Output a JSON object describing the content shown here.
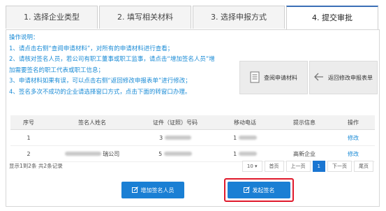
{
  "tabs": [
    {
      "label": "1. 选择企业类型",
      "active": false
    },
    {
      "label": "2. 填写相关材料",
      "active": false
    },
    {
      "label": "3. 选择申报方式",
      "active": false
    },
    {
      "label": "4. 提交审批",
      "active": true
    }
  ],
  "instructions": {
    "title": "操作说明：",
    "lines": [
      "1、请点击右侧“查阅申请材料”，对所有的申请材料进行查看；",
      "2、请核对签名人员，若公司有职工董事或职工监事，请点击“增加签名人员”增",
      "加需要签名的职工代表或职工信息；",
      "3、申请材料如果有误，可以点击右侧“返回修改申报表单”进行修改；",
      "4、签名多次不成功的企业请选择窗口方式，点击下面的转窗口办理。"
    ]
  },
  "side_buttons": {
    "view_materials": "查阅申请材料",
    "return_modify": "返回修改申报表单"
  },
  "table": {
    "headers": [
      "序号",
      "签名人姓名",
      "证件（证照）号码",
      "移动电话",
      "提示信息",
      "操作"
    ],
    "rows": [
      {
        "index": "1",
        "name": "",
        "id_no": "3",
        "phone": "1",
        "hint": "",
        "action": "修改"
      },
      {
        "index": "2",
        "name": "瑞公司",
        "id_no": "5",
        "phone": "1",
        "hint": "高新企业",
        "action": "修改"
      }
    ]
  },
  "summary": "显示1到2条 共2条记录",
  "pager": {
    "page_size": "10 ▾",
    "first": "首页",
    "prev": "上一页",
    "current": "1",
    "next": "下一页",
    "last": "尾页"
  },
  "actions": {
    "add_signer": "增加签名人员",
    "start_sign": "发起签名"
  },
  "colors": {
    "accent": "#1a7fd4",
    "highlight": "#e0192b",
    "instruction_text": "#1a8bd6"
  }
}
